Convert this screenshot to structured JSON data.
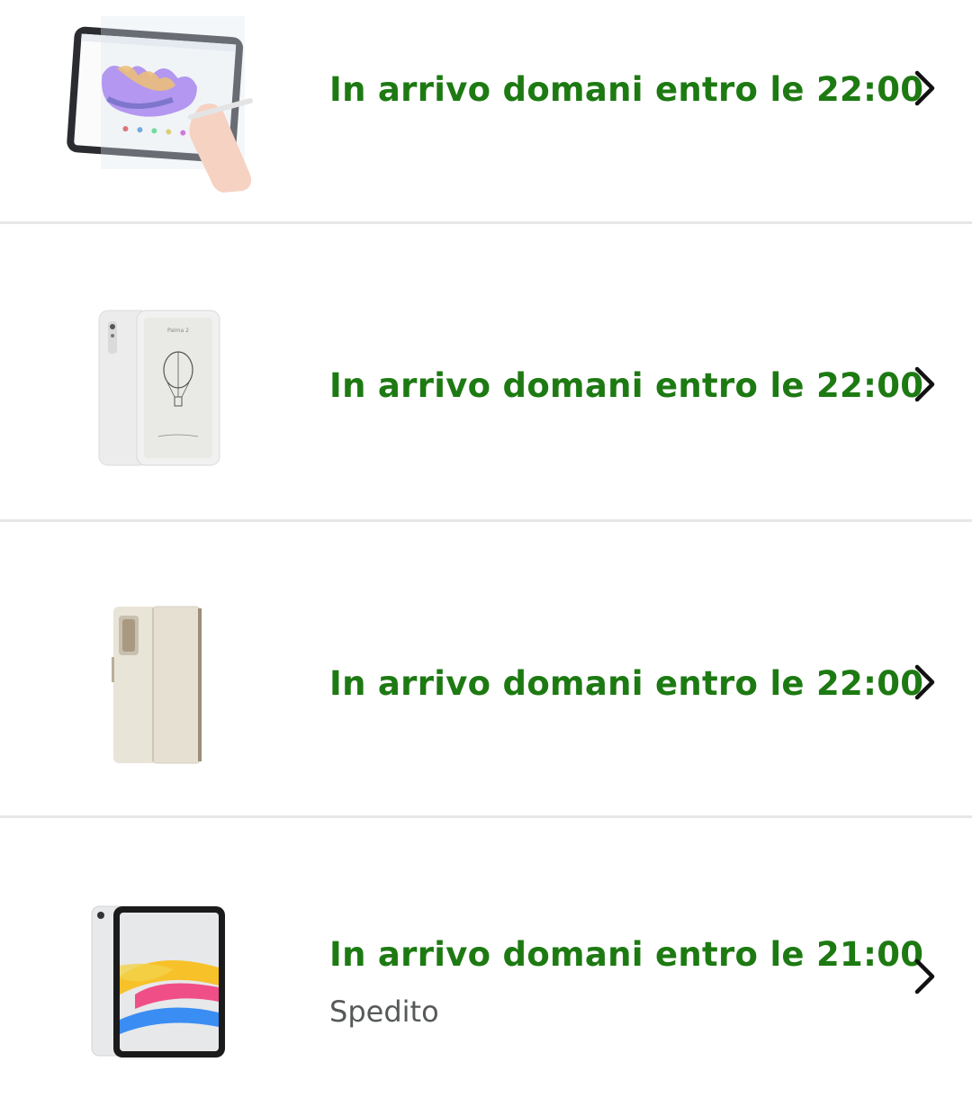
{
  "colors": {
    "status_green": "#1d7a12",
    "sub_gray": "#565959",
    "divider": "#e6e7e8",
    "chevron": "#111111"
  },
  "orders": [
    {
      "image": "paper-screen-protector-tablet",
      "status": "In arrivo domani entro le 22:00",
      "substatus": ""
    },
    {
      "image": "eink-phone-white",
      "status": "In arrivo domani entro le 22:00",
      "substatus": ""
    },
    {
      "image": "phone-folio-case-beige",
      "status": "In arrivo domani entro le 22:00",
      "substatus": ""
    },
    {
      "image": "ipad-silver",
      "status": "In arrivo domani entro le 21:00",
      "substatus": "Spedito"
    }
  ],
  "icons": {
    "row_chevron": "chevron-right-icon"
  }
}
